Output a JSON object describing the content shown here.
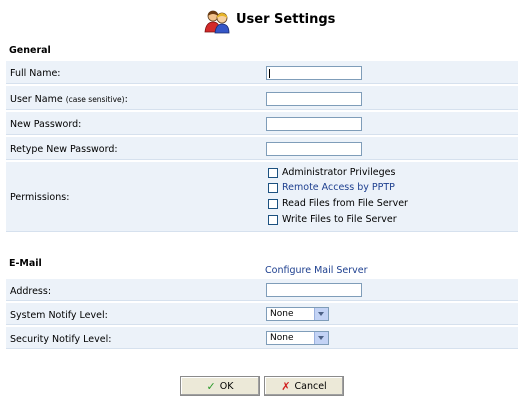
{
  "header": {
    "title": "User Settings",
    "icon": "users-icon"
  },
  "general": {
    "heading": "General",
    "full_name": {
      "label": "Full Name:",
      "value": ""
    },
    "user_name": {
      "label": "User Name",
      "hint": "(case sensitive)",
      "colon": ":",
      "value": ""
    },
    "new_password": {
      "label": "New Password:",
      "value": ""
    },
    "retype_password": {
      "label": "Retype New Password:",
      "value": ""
    },
    "permissions": {
      "label": "Permissions:",
      "options": [
        {
          "label": "Administrator Privileges",
          "checked": false
        },
        {
          "label": "Remote Access by PPTP",
          "checked": false
        },
        {
          "label": "Read Files from File Server",
          "checked": false
        },
        {
          "label": "Write Files to File Server",
          "checked": false
        }
      ]
    }
  },
  "email": {
    "heading": "E-Mail",
    "configure_link": "Configure Mail Server",
    "address": {
      "label": "Address:",
      "value": ""
    },
    "system_notify": {
      "label": "System Notify Level:",
      "selected": "None"
    },
    "security_notify": {
      "label": "Security Notify Level:",
      "selected": "None"
    }
  },
  "buttons": {
    "ok": "OK",
    "cancel": "Cancel"
  },
  "colors": {
    "row_bg": "#ecf2f9",
    "link": "#1d3f8f",
    "ok_check": "#2a9a2a",
    "cancel_x": "#d01f1f"
  }
}
